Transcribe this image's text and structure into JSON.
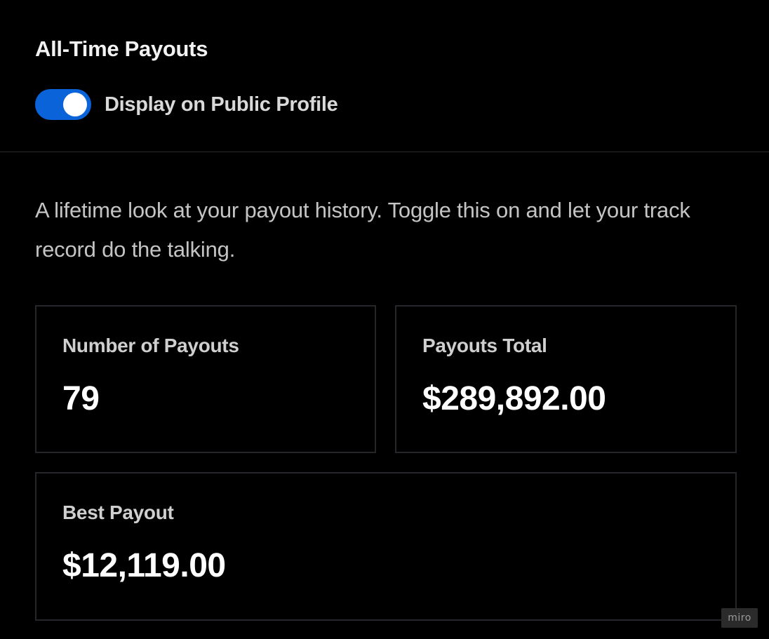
{
  "header": {
    "title": "All-Time Payouts",
    "toggle": {
      "label": "Display on Public Profile",
      "state": "on",
      "color": "#0a63d8"
    }
  },
  "description": "A lifetime look at your payout history. Toggle this on and let your track record do the talking.",
  "stats": {
    "number_of_payouts": {
      "label": "Number of Payouts",
      "value": "79"
    },
    "payouts_total": {
      "label": "Payouts Total",
      "value": "$289,892.00"
    },
    "best_payout": {
      "label": "Best Payout",
      "value": "$12,119.00"
    }
  },
  "watermark": "miro"
}
